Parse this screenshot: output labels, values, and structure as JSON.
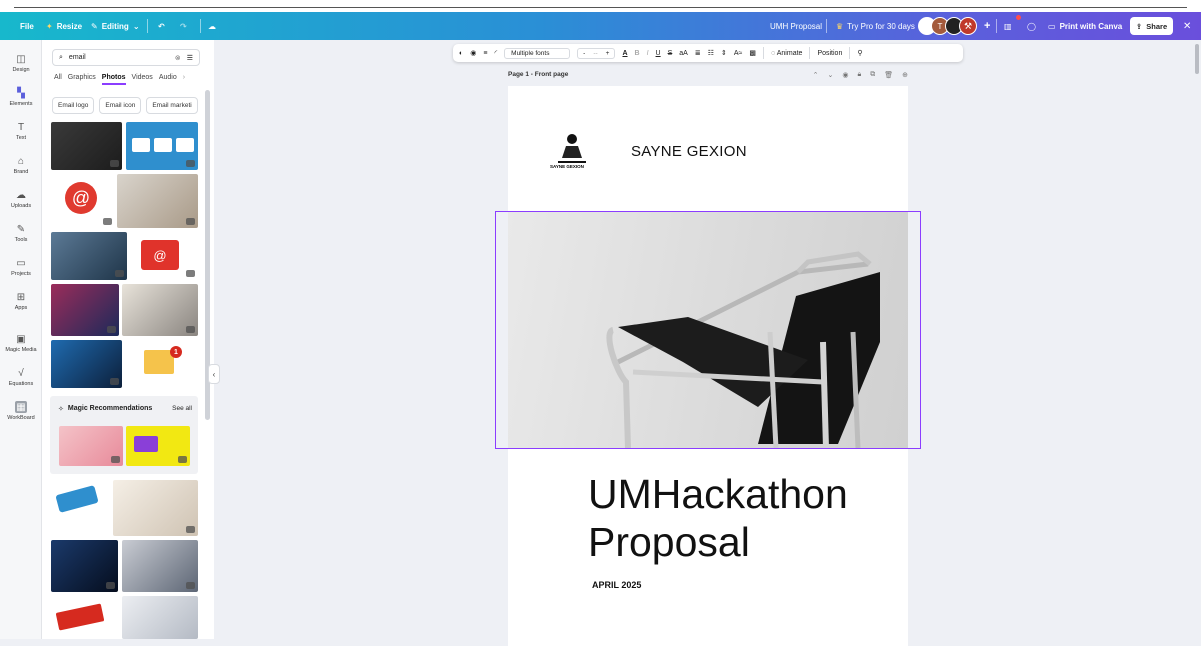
{
  "topbar": {
    "file": "File",
    "resize": "Resize",
    "editing": "Editing",
    "doc_title": "UMH Proposal",
    "try_pro": "Try Pro for 30 days",
    "avatar_letter": "T",
    "print": "Print with Canva",
    "share": "Share"
  },
  "rail": [
    {
      "label": "Design",
      "icon": "layout-icon"
    },
    {
      "label": "Elements",
      "icon": "elements-icon"
    },
    {
      "label": "Text",
      "icon": "text-icon"
    },
    {
      "label": "Brand",
      "icon": "brand-icon"
    },
    {
      "label": "Uploads",
      "icon": "upload-icon"
    },
    {
      "label": "Tools",
      "icon": "pen-icon"
    },
    {
      "label": "Projects",
      "icon": "folder-icon"
    },
    {
      "label": "Apps",
      "icon": "apps-icon"
    },
    {
      "label": "Magic Media",
      "icon": "magic-media-icon"
    },
    {
      "label": "Equations",
      "icon": "equation-icon"
    },
    {
      "label": "WorkBoard",
      "icon": "workboard-icon"
    }
  ],
  "panel": {
    "search_value": "email",
    "tabs": [
      "All",
      "Graphics",
      "Photos",
      "Videos",
      "Audio"
    ],
    "active_tab": "Photos",
    "chips": [
      "Email logo",
      "Email icon",
      "Email marketi"
    ],
    "magic_title": "Magic Recommendations",
    "see_all": "See all"
  },
  "toolbar": {
    "font": "Multiple fonts",
    "size_minus": "-",
    "size_value": "--",
    "size_plus": "+",
    "animate": "Animate",
    "position": "Position"
  },
  "page": {
    "header": "Page 1 - Front page",
    "company": "SAYNE GEXION",
    "logo_text": "SAYNE GEXION",
    "title_line1": "UMHackathon",
    "title_line2": "Proposal",
    "date": "APRIL 2025"
  },
  "colors": {
    "accent": "#8b3dff",
    "topbar_start": "#17b8cc",
    "topbar_end": "#6a4fdc"
  }
}
